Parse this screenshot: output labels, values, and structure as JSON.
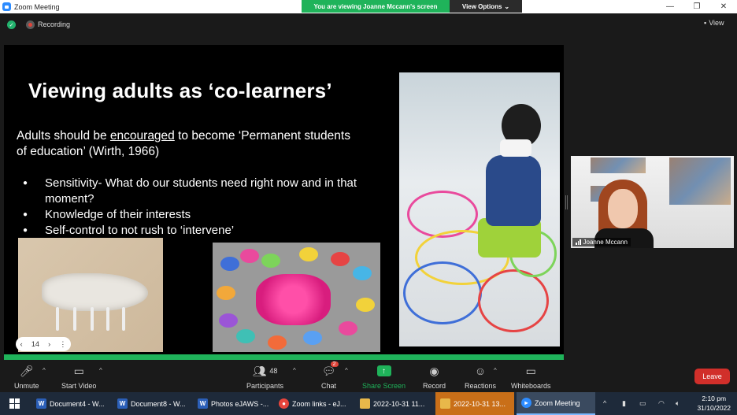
{
  "window": {
    "title": "Zoom Meeting",
    "banner": "You are viewing Joanne Mccann's screen",
    "view_options": "View Options"
  },
  "top": {
    "recording": "Recording",
    "view": "View"
  },
  "slide": {
    "title": "Viewing adults as ‘co-learners’",
    "body_pre": "Adults should be ",
    "body_underlined": "encouraged",
    "body_post": " to become ‘Permanent students of education’ (Wirth, 1966)",
    "bullets": [
      "Sensitivity- What do our students need right now and in that moment?",
      "Knowledge of their interests",
      "Self-control to not rush to ‘intervene’"
    ],
    "page_number": "14"
  },
  "participant": {
    "name": "Joanne Mccann"
  },
  "toolbar": {
    "unmute": "Unmute",
    "start_video": "Start Video",
    "participants": "Participants",
    "participants_count": "48",
    "chat": "Chat",
    "chat_badge": "2",
    "share_screen": "Share Screen",
    "record": "Record",
    "reactions": "Reactions",
    "whiteboards": "Whiteboards",
    "leave": "Leave"
  },
  "taskbar": {
    "items": [
      {
        "label": "Document4 - W...",
        "icon": "W",
        "color": "#2b5fb8"
      },
      {
        "label": "Document8 - W...",
        "icon": "W",
        "color": "#2b5fb8"
      },
      {
        "label": "Photos eJAWS -...",
        "icon": "W",
        "color": "#2b5fb8"
      },
      {
        "label": "Zoom links - eJ...",
        "icon": "chrome",
        "color": "#e8453c"
      },
      {
        "label": "2022-10-31 11...",
        "icon": "folder",
        "color": "#e8b84a"
      },
      {
        "label": "2022-10-31 13...",
        "icon": "folder",
        "color": "#e8b84a"
      },
      {
        "label": "Zoom Meeting",
        "icon": "zoom",
        "color": "#2d8cff"
      }
    ],
    "time": "2:10 pm",
    "date": "31/10/2022"
  },
  "colors": {
    "accent_green": "#1fb35a",
    "leave_red": "#d12f2a",
    "zoom_blue": "#2d8cff"
  }
}
